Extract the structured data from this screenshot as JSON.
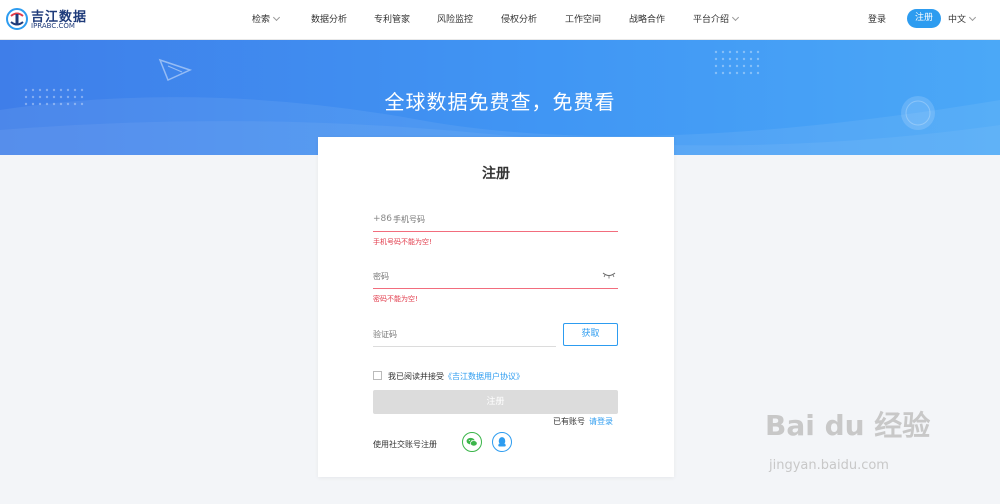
{
  "header": {
    "logo_title": "吉江数据",
    "logo_sub": "IPRABC.COM",
    "nav": [
      {
        "label": "检索"
      },
      {
        "label": "数据分析"
      },
      {
        "label": "专利管家"
      },
      {
        "label": "风险监控"
      },
      {
        "label": "侵权分析"
      },
      {
        "label": "工作空间"
      },
      {
        "label": "战略合作"
      },
      {
        "label": "平台介绍"
      }
    ],
    "login": "登录",
    "register": "注册",
    "language": "中文"
  },
  "banner": {
    "title": "全球数据免费查，免费看"
  },
  "form": {
    "title": "注册",
    "phone_prefix": "+86",
    "phone_placeholder": "手机号码",
    "phone_error": "手机号码不能为空!",
    "password_placeholder": "密码",
    "password_error": "密码不能为空!",
    "code_placeholder": "验证码",
    "get_code": "获取",
    "agree_text": "我已阅读并接受",
    "agree_link": "《吉江数据用户协议》",
    "submit": "注册",
    "has_account": "已有账号",
    "login_link": "请登录",
    "social_label": "使用社交账号注册"
  },
  "watermark": {
    "text": "Bai du 经验",
    "sub": "jingyan.baidu.com"
  },
  "colors": {
    "accent": "#2d9cf0",
    "error": "#e23b4b",
    "banner": "#4096f4"
  }
}
